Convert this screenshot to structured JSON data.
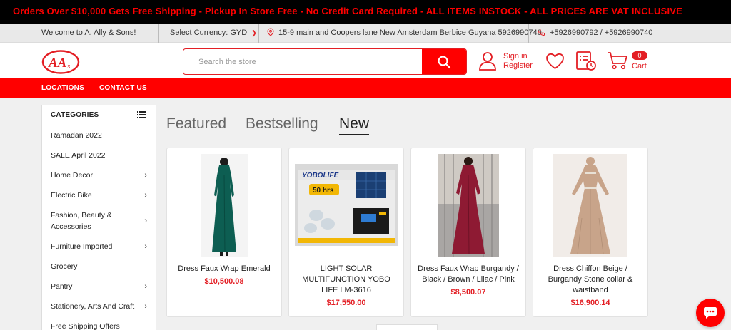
{
  "promo": {
    "text": "Orders Over $10,000 Gets Free Shipping - Pickup In Store Free - No Credit Card Required - ALL ITEMS INSTOCK - ALL PRICES ARE VAT INCLUSIVE"
  },
  "info_bar": {
    "welcome": "Welcome to A. Ally & Sons!",
    "currency_label": "Select Currency: GYD",
    "address": "15-9 main and Coopers lane New Amsterdam Berbice Guyana 5926990740",
    "phone": "+5926990792 / +5926990740"
  },
  "header": {
    "logo_text": "AA",
    "search_placeholder": "Search the store",
    "signin_label": "Sign in",
    "register_label": "Register",
    "cart_count": "0",
    "cart_label": "Cart"
  },
  "nav": {
    "locations": "LOCATIONS",
    "contact": "CONTACT US"
  },
  "sidebar": {
    "heading": "CATEGORIES",
    "items": [
      {
        "label": "Ramadan 2022"
      },
      {
        "label": "SALE April 2022"
      },
      {
        "label": "Home Decor"
      },
      {
        "label": "Electric Bike"
      },
      {
        "label": "Fashion, Beauty &"
      },
      {
        "label": "Accessories"
      },
      {
        "label": "Furniture Imported"
      },
      {
        "label": "Grocery"
      },
      {
        "label": "Pantry"
      },
      {
        "label": "Stationery, Arts And Craft"
      },
      {
        "label": "Free Shipping Offers"
      }
    ]
  },
  "tabs": {
    "featured": "Featured",
    "bestselling": "Bestselling",
    "new": "New"
  },
  "products": [
    {
      "title": "Dress Faux Wrap Emerald",
      "price": "$10,500.08"
    },
    {
      "title": "LIGHT SOLAR MULTIFUNCTION YOBO LIFE LM-3616",
      "price": "$17,550.00"
    },
    {
      "title": "Dress Faux Wrap Burgandy / Black / Brown / Lilac / Pink",
      "price": "$8,500.07"
    },
    {
      "title": "Dress Chiffon Beige / Burgandy Stone collar & waistband",
      "price": "$16,900.14"
    }
  ],
  "product_image_text": {
    "brand": "YOBOLIFE",
    "hrs": "50 hrs"
  },
  "colors": {
    "brand_red": "#e31e24",
    "promo_red": "#ff0000",
    "emerald": "#0d5e52",
    "burgundy": "#8e1a33",
    "beige": "#c8a48a"
  }
}
